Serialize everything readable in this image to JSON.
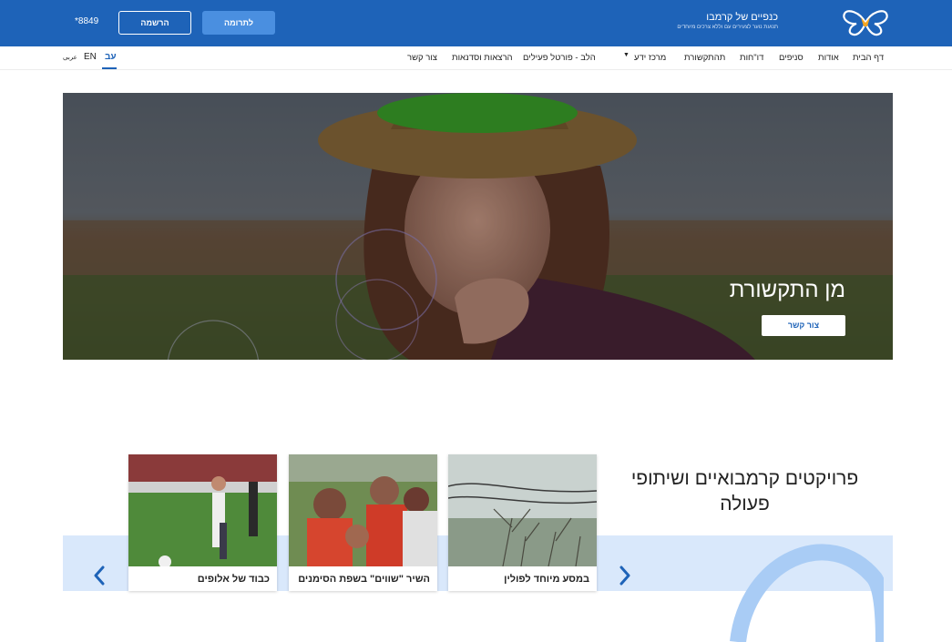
{
  "header": {
    "logo_title": "כנפיים של קרמבו",
    "logo_subtitle": "תנועת נוער לצעירים עם וללא צרכים מיוחדים",
    "donate_label": "לתרומה",
    "register_label": "הרשמה",
    "phone": "*8849"
  },
  "nav": {
    "items": [
      "דף הבית",
      "אודות",
      "סניפים",
      "דו\"חות",
      "תהתקשורת",
      "מרכז ידע",
      "הלב - פורטל פעילים",
      "הרצאות וסדנאות",
      "צור קשר"
    ],
    "dropdown_caret": "▼",
    "lang_he": "עב",
    "lang_en": "EN",
    "lang_ar": "عربى"
  },
  "hero": {
    "title": "מן התקשורת",
    "button_label": "צור קשר"
  },
  "projects": {
    "title": "פרויקטים קרמבואיים ושיתופי פעולה",
    "cards": [
      {
        "title": "במסע מיוחד לפולין"
      },
      {
        "title": "השיר \"שווים\" בשפת הסימנים"
      },
      {
        "title": "כבוד של אלופים"
      }
    ]
  },
  "colors": {
    "brand_blue": "#1e63b8",
    "button_blue": "#4a8fe0",
    "section_light_blue": "#d9e8fb"
  },
  "icons": [
    "butterfly-logo-icon",
    "chevron-right-icon",
    "chevron-left-icon",
    "caret-down-icon"
  ]
}
